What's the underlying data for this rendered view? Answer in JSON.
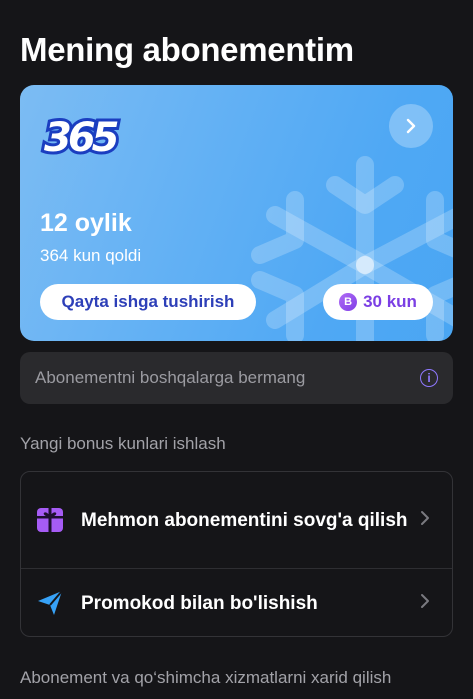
{
  "header": {
    "title": "Mening abonementim"
  },
  "subscription": {
    "logo_text": "365",
    "plan": "12 oylik",
    "days_left": "364 kun qoldi",
    "restart_label": "Qayta ishga tushirish",
    "bonus_coin": "B",
    "bonus_days": "30 kun",
    "gradient_colors": [
      "#7cbcf3",
      "#4aa6f3"
    ]
  },
  "notice": {
    "text": "Abonementni boshqalarga bermang",
    "icon": "info-icon"
  },
  "bonus_section": {
    "label": "Yangi bonus kunlari ishlash",
    "items": [
      {
        "label": "Mehmon abonementini sovg'a qilish",
        "icon": "gift-icon"
      },
      {
        "label": "Promokod bilan bo'lishish",
        "icon": "send-icon"
      }
    ]
  },
  "purchase_section": {
    "label": "Abonement va qo‘shimcha xizmatlarni xarid qilish"
  },
  "colors": {
    "accent_purple": "#8f78ff",
    "background": "#151518",
    "card_dark": "#2a2a2d"
  }
}
